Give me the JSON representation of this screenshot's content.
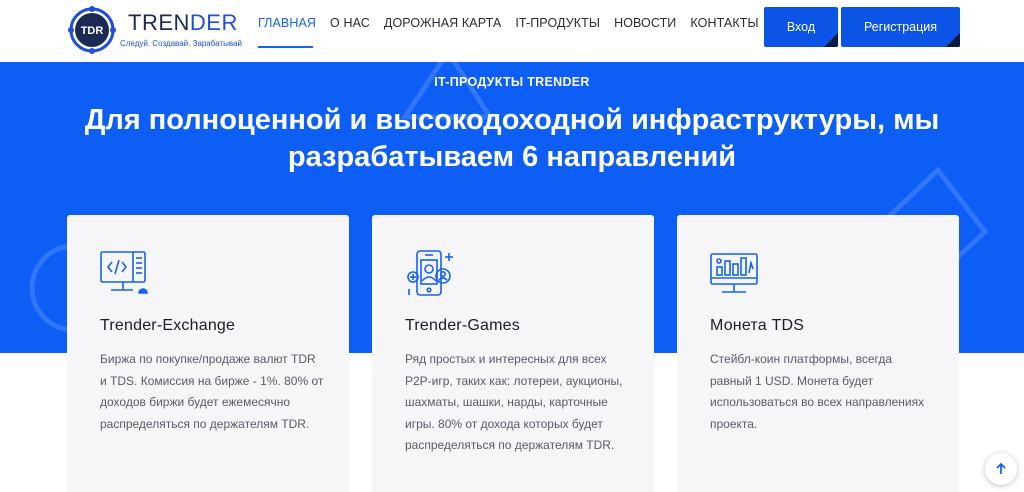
{
  "header": {
    "logo": {
      "badge_text": "TDR",
      "title_part1": "TREN",
      "title_part2": "DER",
      "tagline": "Следуй. Создавай. Зарабатывай"
    },
    "nav": [
      {
        "label": "ГЛАВНАЯ",
        "active": true
      },
      {
        "label": "О НАС",
        "active": false
      },
      {
        "label": "ДОРОЖНАЯ КАРТА",
        "active": false
      },
      {
        "label": "IT-ПРОДУКТЫ",
        "active": false
      },
      {
        "label": "НОВОСТИ",
        "active": false
      },
      {
        "label": "КОНТАКТЫ",
        "active": false
      }
    ],
    "login_label": "Вход",
    "register_label": "Регистрация"
  },
  "hero": {
    "eyebrow": "IT-ПРОДУКТЫ TRENDER",
    "title": "Для полноценной и высокодоходной инфраструктуры, мы разрабатываем 6 направлений"
  },
  "cards": [
    {
      "icon": "monitor-code-icon",
      "title": "Trender-Exchange",
      "text": "Биржа по покупке/продаже валют TDR и TDS. Комиссия на бирже - 1%. 80% от доходов биржи будет ежемесячно распределяться по держателям TDR."
    },
    {
      "icon": "mobile-game-icon",
      "title": "Trender-Games",
      "text": "Ряд простых и интересных для всех P2P-игр, таких как: лотереи, аукционы, шахматы, шашки, нарды, карточные игры. 80% от дохода которых будет распределяться по держателям TDR."
    },
    {
      "icon": "monitor-chart-icon",
      "title": "Монета TDS",
      "text": "Стейбл-коин платформы, всегда равный 1 USD. Монета будет использоваться во всех направлениях проекта."
    }
  ],
  "colors": {
    "primary": "#0c5ef5",
    "button": "#0c54e6",
    "nav_active": "#1463f2",
    "dark": "#1a2a55"
  }
}
